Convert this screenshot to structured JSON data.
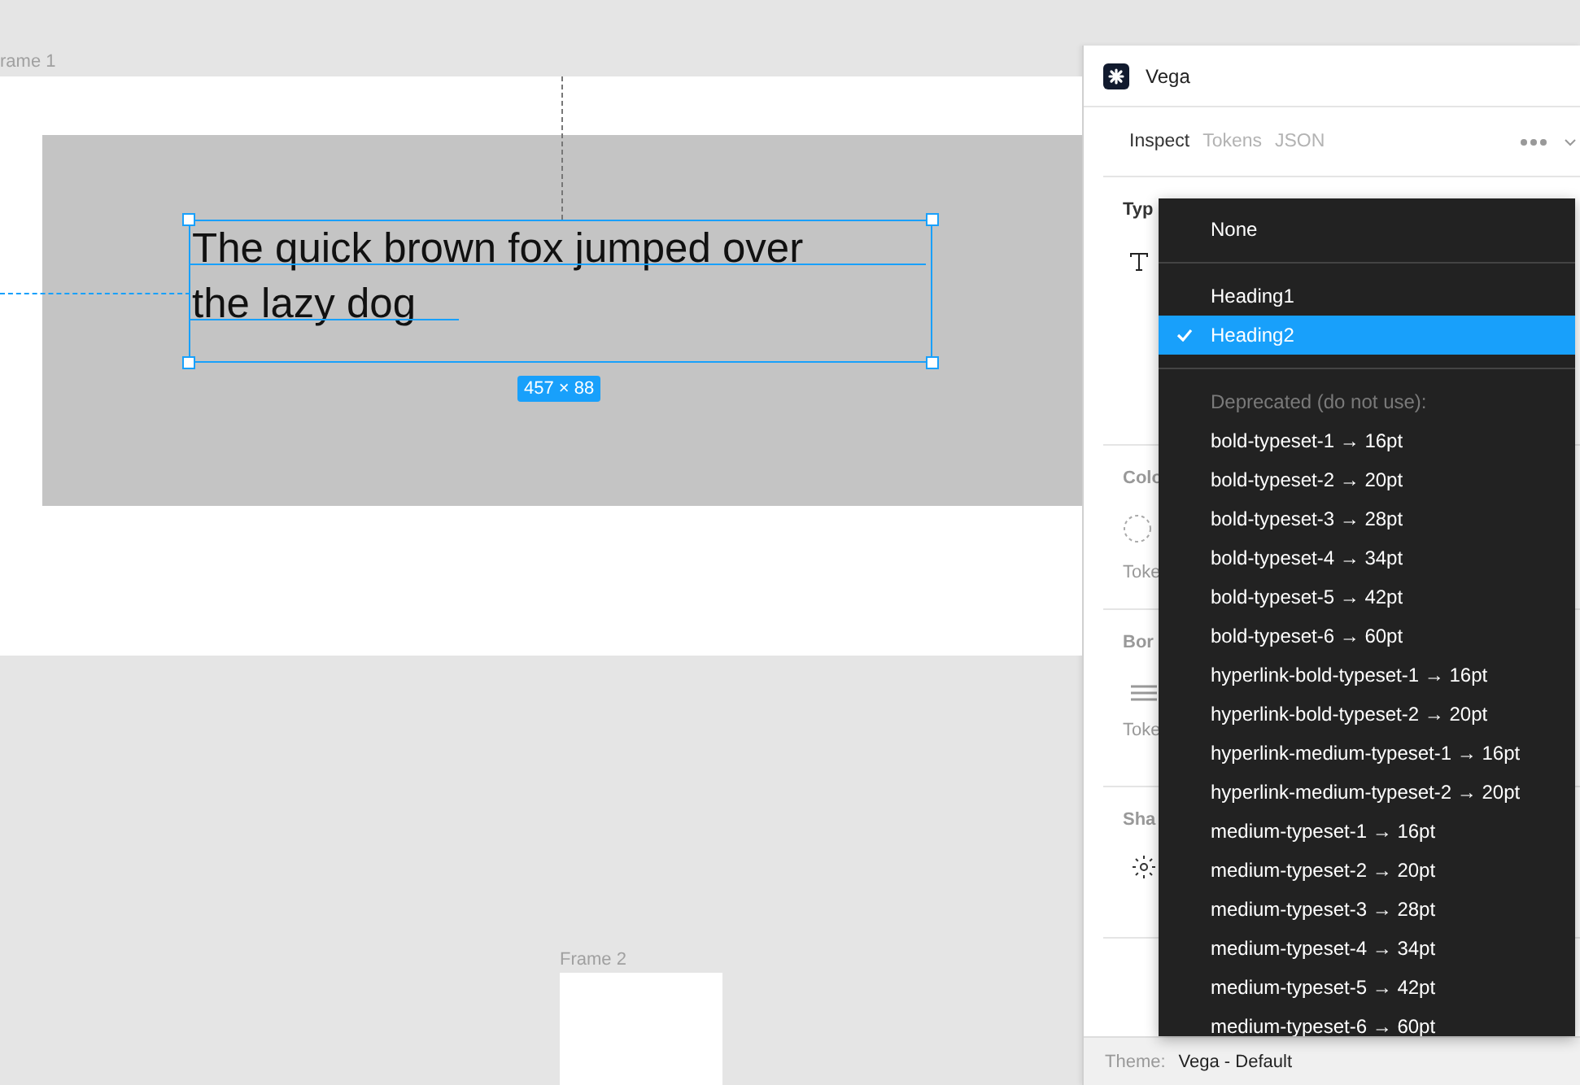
{
  "canvas": {
    "frames": [
      {
        "label": "rame 1",
        "kind": "main"
      },
      {
        "label": "Frame 2",
        "kind": "small"
      }
    ],
    "text_layer": {
      "text": "The quick brown fox jumped over the lazy dog",
      "size_badge": "457 × 88",
      "selected": true
    }
  },
  "plugin": {
    "title": "Vega",
    "tabs": [
      {
        "label": "Inspect",
        "selected": true
      },
      {
        "label": "Tokens",
        "selected": false
      },
      {
        "label": "JSON",
        "selected": false
      }
    ],
    "sections": [
      {
        "label": "Typ",
        "kind": "type"
      },
      {
        "label": "Colo",
        "kind": "color",
        "sublabel": "Toke"
      },
      {
        "label": "Bor",
        "kind": "border",
        "sublabel": "Toke"
      },
      {
        "label": "Sha",
        "kind": "shadow"
      }
    ],
    "theme_label": "Theme:",
    "theme_value": "Vega - Default"
  },
  "dropdown": {
    "groups": [
      {
        "options": [
          {
            "label": "None",
            "selected": false
          }
        ]
      },
      {
        "options": [
          {
            "label": "Heading1",
            "selected": false
          },
          {
            "label": "Heading2",
            "selected": true
          }
        ]
      },
      {
        "header": "Deprecated (do not use):",
        "options": [
          {
            "label": "bold-typeset-1 → 16pt",
            "selected": false
          },
          {
            "label": "bold-typeset-2 → 20pt",
            "selected": false
          },
          {
            "label": "bold-typeset-3 → 28pt",
            "selected": false
          },
          {
            "label": "bold-typeset-4 → 34pt",
            "selected": false
          },
          {
            "label": "bold-typeset-5 → 42pt",
            "selected": false
          },
          {
            "label": "bold-typeset-6 → 60pt",
            "selected": false
          },
          {
            "label": "hyperlink-bold-typeset-1 → 16pt",
            "selected": false
          },
          {
            "label": "hyperlink-bold-typeset-2 → 20pt",
            "selected": false
          },
          {
            "label": "hyperlink-medium-typeset-1 → 16pt",
            "selected": false
          },
          {
            "label": "hyperlink-medium-typeset-2 → 20pt",
            "selected": false
          },
          {
            "label": "medium-typeset-1 → 16pt",
            "selected": false
          },
          {
            "label": "medium-typeset-2 → 20pt",
            "selected": false
          },
          {
            "label": "medium-typeset-3 → 28pt",
            "selected": false
          },
          {
            "label": "medium-typeset-4 → 34pt",
            "selected": false
          },
          {
            "label": "medium-typeset-5 → 42pt",
            "selected": false
          },
          {
            "label": "medium-typeset-6 → 60pt",
            "selected": false
          }
        ]
      }
    ]
  }
}
